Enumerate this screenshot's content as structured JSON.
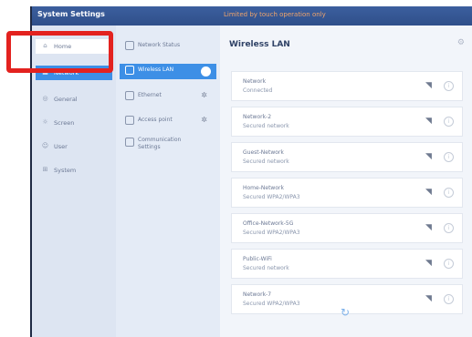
{
  "window": {
    "title": "System Settings",
    "warning": "Limited by touch operation only"
  },
  "nav": [
    {
      "label": "Home",
      "icon": "home-icon",
      "glyph": "⌂"
    },
    {
      "label": "Network",
      "icon": "network-icon",
      "glyph": "▦"
    },
    {
      "label": "General",
      "icon": "general-icon",
      "glyph": "◎"
    },
    {
      "label": "Screen",
      "icon": "screen-icon",
      "glyph": "☼"
    },
    {
      "label": "User",
      "icon": "user-icon",
      "glyph": "☺"
    },
    {
      "label": "System",
      "icon": "system-icon",
      "glyph": "⊞"
    }
  ],
  "subnav": [
    {
      "label": "Network Status"
    },
    {
      "label": "Wireless LAN"
    },
    {
      "label": "Ethernet"
    },
    {
      "label": "Access point"
    },
    {
      "label": "Communication",
      "label2": "Settings"
    }
  ],
  "main": {
    "title": "Wireless LAN",
    "networks": [
      {
        "name": "Network",
        "status": "Connected"
      },
      {
        "name": "Network-2",
        "status": "Secured network"
      },
      {
        "name": "Guest-Network",
        "status": "Secured network"
      },
      {
        "name": "Home-Network",
        "status": "Secured WPA2/WPA3"
      },
      {
        "name": "Office-Network-5G",
        "status": "Secured WPA2/WPA3"
      },
      {
        "name": "Public-WiFi",
        "status": "Secured network"
      },
      {
        "name": "Network-7",
        "status": "Secured WPA2/WPA3"
      }
    ]
  },
  "colors": {
    "accent": "#3d8fe6",
    "titlebar": "#2f4f8a",
    "highlight": "#e3221f",
    "warning": "#f0a46b"
  }
}
